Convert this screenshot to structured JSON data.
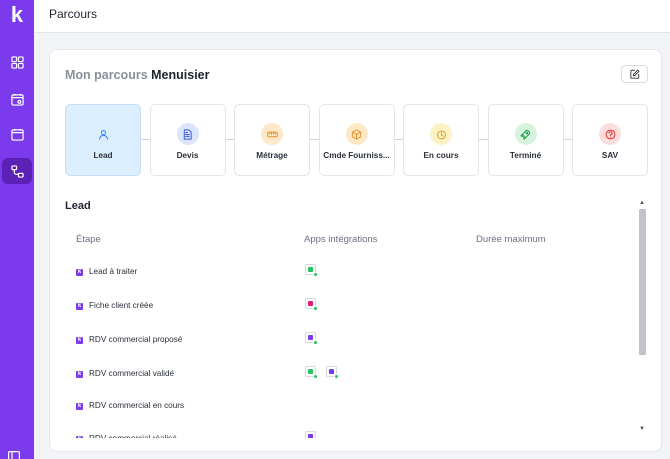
{
  "header": {
    "title": "Parcours"
  },
  "card": {
    "title_prefix": "Mon parcours",
    "title_trade": "Menuisier"
  },
  "steps": [
    {
      "label": "Lead",
      "icon": "user-icon",
      "color": "#dbeefd",
      "iconColor": "#3b82f6",
      "active": true
    },
    {
      "label": "Devis",
      "icon": "document-icon",
      "color": "#dbe5fb",
      "iconColor": "#3b5bdb"
    },
    {
      "label": "Métrage",
      "icon": "ruler-icon",
      "color": "#fde9c7",
      "iconColor": "#e3932c"
    },
    {
      "label": "Cmde Fourniss...",
      "icon": "box-icon",
      "color": "#fde9c7",
      "iconColor": "#e3932c"
    },
    {
      "label": "En cours",
      "icon": "clock-icon",
      "color": "#fcf2c5",
      "iconColor": "#d6a51f"
    },
    {
      "label": "Terminé",
      "icon": "rocket-icon",
      "color": "#d7f3de",
      "iconColor": "#1f9d4a"
    },
    {
      "label": "SAV",
      "icon": "help-icon",
      "color": "#fddcdc",
      "iconColor": "#e03131"
    }
  ],
  "section": {
    "title": "Lead"
  },
  "columns": {
    "etape": "Étape",
    "apps": "Apps intégrations",
    "duree": "Durée maximum"
  },
  "rows": [
    {
      "label": "Lead à traiter",
      "apps": [
        {
          "icon": "globe-app-icon",
          "color": "#22c55e"
        }
      ]
    },
    {
      "label": "Fiche client créée",
      "apps": [
        {
          "icon": "form-app-icon",
          "color": "#e11d74"
        }
      ]
    },
    {
      "label": "RDV commercial proposé",
      "apps": [
        {
          "icon": "calendar-app-icon",
          "color": "#7c3aed"
        }
      ]
    },
    {
      "label": "RDV commercial validé",
      "apps": [
        {
          "icon": "globe-app-icon",
          "color": "#22c55e"
        },
        {
          "icon": "calendar-app-icon",
          "color": "#7c3aed"
        }
      ]
    },
    {
      "label": "RDV commercial en cours",
      "apps": []
    },
    {
      "label": "RDV commercial réalisé",
      "apps": [
        {
          "icon": "calendar-app-icon",
          "color": "#7c3aed"
        }
      ]
    }
  ]
}
